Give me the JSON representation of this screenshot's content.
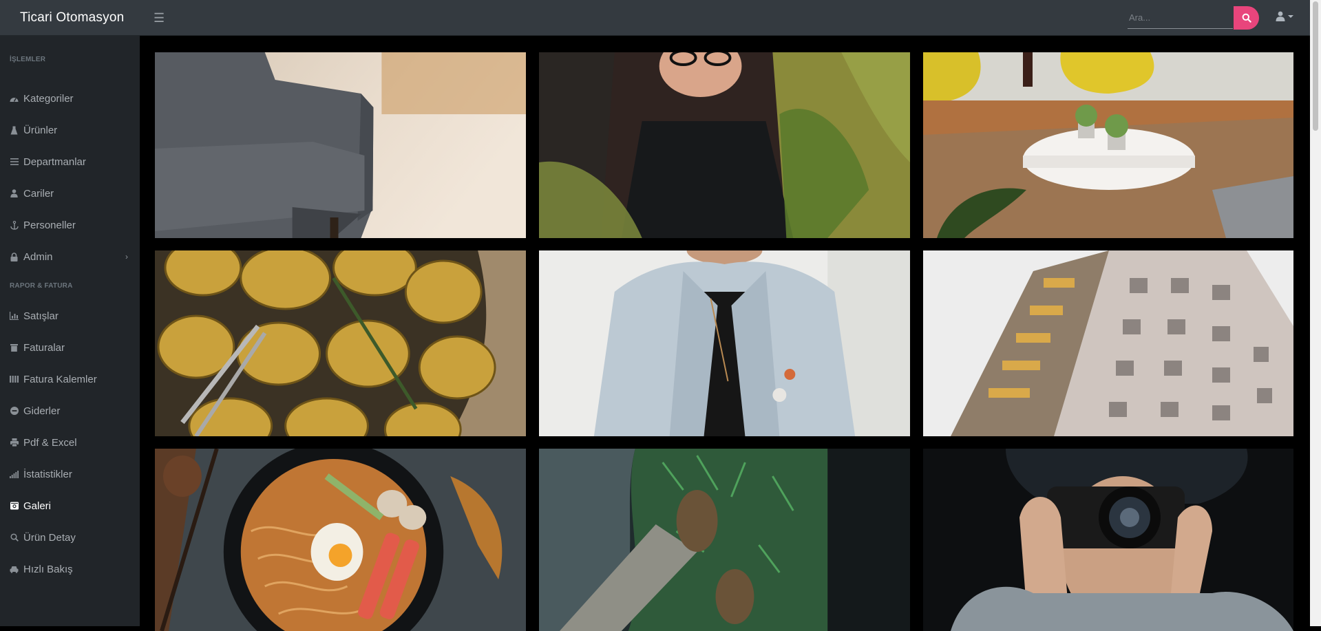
{
  "app": {
    "brand": "Ticari Otomasyon"
  },
  "search": {
    "placeholder": "Ara..."
  },
  "sidebar": {
    "sections": [
      {
        "heading": "İŞLEMLER"
      },
      {
        "heading": "RAPOR & FATURA"
      }
    ],
    "items": [
      {
        "label": "Kategoriler",
        "icon": "tachometer-icon"
      },
      {
        "label": "Ürünler",
        "icon": "flask-icon"
      },
      {
        "label": "Departmanlar",
        "icon": "list-icon"
      },
      {
        "label": "Cariler",
        "icon": "user-icon"
      },
      {
        "label": "Personeller",
        "icon": "anchor-icon"
      },
      {
        "label": "Admin",
        "icon": "lock-icon"
      },
      {
        "label": "Satışlar",
        "icon": "chart-icon"
      },
      {
        "label": "Faturalar",
        "icon": "trash-icon"
      },
      {
        "label": "Fatura Kalemler",
        "icon": "columns-icon"
      },
      {
        "label": "Giderler",
        "icon": "minus-circle-icon"
      },
      {
        "label": "Pdf & Excel",
        "icon": "print-icon"
      },
      {
        "label": "İstatistikler",
        "icon": "signal-icon"
      },
      {
        "label": "Galeri",
        "icon": "camera-icon"
      },
      {
        "label": "Ürün Detay",
        "icon": "search-icon"
      },
      {
        "label": "Hızlı Bakış",
        "icon": "car-icon"
      }
    ],
    "active": "Galeri"
  },
  "colors": {
    "topbar": "#343a40",
    "sidebar": "#212529",
    "accent": "#e8457c",
    "page": "#000000"
  },
  "gallery": {
    "photos": [
      "armchair-photo",
      "woman-glasses-photo",
      "yellow-chairs-table-photo",
      "potatoes-photo",
      "denim-jacket-photo",
      "building-photo",
      "ramen-photo",
      "hiking-boots-photo",
      "photographer-camera-photo"
    ]
  }
}
